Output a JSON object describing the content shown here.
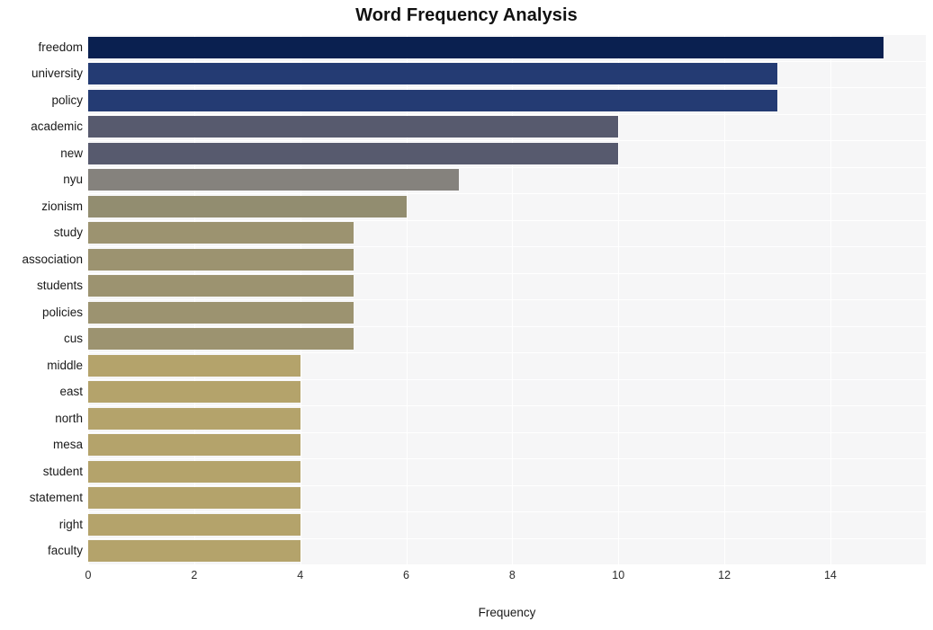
{
  "chart_data": {
    "type": "bar",
    "orientation": "horizontal",
    "title": "Word Frequency Analysis",
    "xlabel": "Frequency",
    "ylabel": "",
    "xlim": [
      0,
      15.8
    ],
    "ylim": [
      0,
      20
    ],
    "grid": true,
    "legend": null,
    "xticks": [
      "0",
      "2",
      "4",
      "6",
      "8",
      "10",
      "12",
      "14"
    ],
    "xtick_values": [
      0,
      2,
      4,
      6,
      8,
      10,
      12,
      14
    ],
    "categories": [
      "freedom",
      "university",
      "policy",
      "academic",
      "new",
      "nyu",
      "zionism",
      "study",
      "association",
      "students",
      "policies",
      "cus",
      "middle",
      "east",
      "north",
      "mesa",
      "student",
      "statement",
      "right",
      "faculty"
    ],
    "values": [
      15,
      13,
      13,
      10,
      10,
      7,
      6,
      5,
      5,
      5,
      5,
      5,
      4,
      4,
      4,
      4,
      4,
      4,
      4,
      4
    ],
    "bar_colors": [
      "#0a2050",
      "#243b73",
      "#243b73",
      "#575a6e",
      "#575a6e",
      "#85827d",
      "#928d70",
      "#9c9370",
      "#9c9370",
      "#9c9370",
      "#9c9370",
      "#9c9370",
      "#b4a36b",
      "#b4a36b",
      "#b4a36b",
      "#b4a36b",
      "#b4a36b",
      "#b4a36b",
      "#b4a36b",
      "#b4a36b"
    ],
    "plot_background": "#f6f6f7",
    "figure_background": "#ffffff",
    "gridline_color": "#ffffff"
  }
}
